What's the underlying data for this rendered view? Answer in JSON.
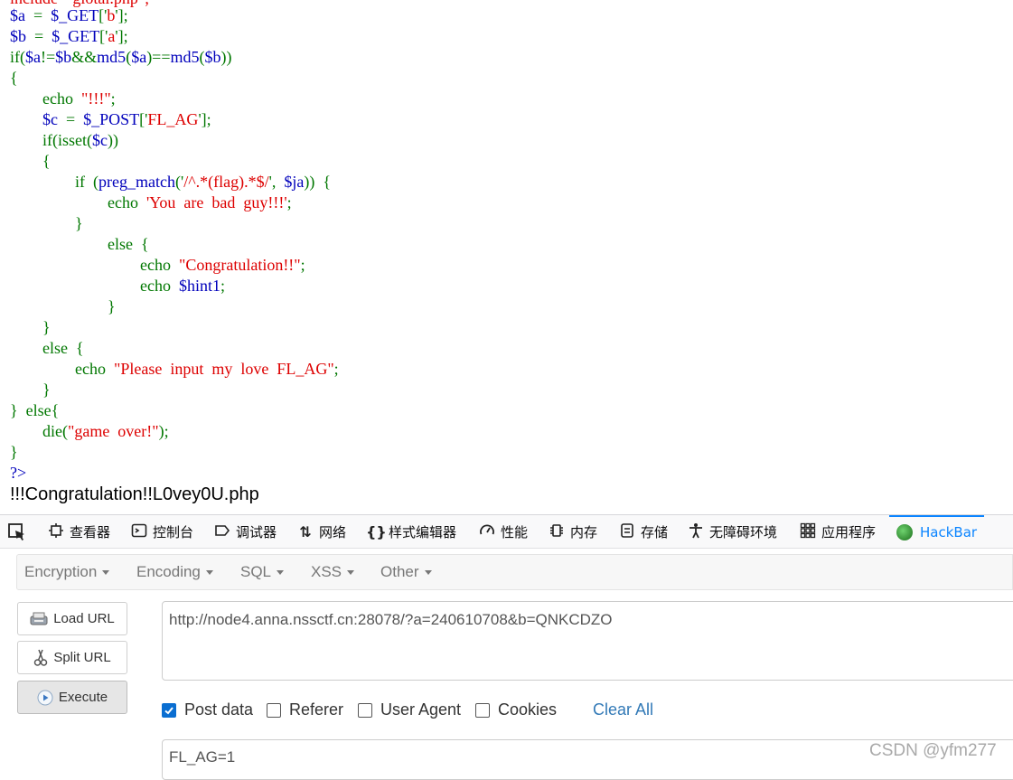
{
  "code_lines": [
    [
      {
        "t": "include  \"glotal.php\";",
        "c": "s"
      }
    ],
    [
      {
        "t": "$a",
        "c": "v"
      },
      {
        "t": "  =  ",
        "c": "k"
      },
      {
        "t": "$_GET",
        "c": "v"
      },
      {
        "t": "['",
        "c": "k"
      },
      {
        "t": "b",
        "c": "s"
      },
      {
        "t": "'];",
        "c": "k"
      }
    ],
    [
      {
        "t": "$b",
        "c": "v"
      },
      {
        "t": "  =  ",
        "c": "k"
      },
      {
        "t": "$_GET",
        "c": "v"
      },
      {
        "t": "['",
        "c": "k"
      },
      {
        "t": "a",
        "c": "s"
      },
      {
        "t": "'];",
        "c": "k"
      }
    ],
    [
      {
        "t": "if(",
        "c": "k"
      },
      {
        "t": "$a",
        "c": "v"
      },
      {
        "t": "!=",
        "c": "k"
      },
      {
        "t": "$b",
        "c": "v"
      },
      {
        "t": "&&",
        "c": "k"
      },
      {
        "t": "md5",
        "c": "v"
      },
      {
        "t": "(",
        "c": "k"
      },
      {
        "t": "$a",
        "c": "v"
      },
      {
        "t": ")==",
        "c": "k"
      },
      {
        "t": "md5",
        "c": "v"
      },
      {
        "t": "(",
        "c": "k"
      },
      {
        "t": "$b",
        "c": "v"
      },
      {
        "t": "))",
        "c": "k"
      }
    ],
    [
      {
        "t": "{",
        "c": "k"
      }
    ],
    [
      {
        "t": "        echo  ",
        "c": "k"
      },
      {
        "t": "\"!!!\"",
        "c": "s"
      },
      {
        "t": ";",
        "c": "k"
      }
    ],
    [
      {
        "t": "        ",
        "c": "k"
      },
      {
        "t": "$c",
        "c": "v"
      },
      {
        "t": "  =  ",
        "c": "k"
      },
      {
        "t": "$_POST",
        "c": "v"
      },
      {
        "t": "['",
        "c": "k"
      },
      {
        "t": "FL_AG",
        "c": "s"
      },
      {
        "t": "'];",
        "c": "k"
      }
    ],
    [
      {
        "t": "        if(isset(",
        "c": "k"
      },
      {
        "t": "$c",
        "c": "v"
      },
      {
        "t": "))",
        "c": "k"
      }
    ],
    [
      {
        "t": "        {",
        "c": "k"
      }
    ],
    [
      {
        "t": "                if  (",
        "c": "k"
      },
      {
        "t": "preg_match",
        "c": "v"
      },
      {
        "t": "('",
        "c": "k"
      },
      {
        "t": "/^.*(flag).*$/",
        "c": "s"
      },
      {
        "t": "',  ",
        "c": "k"
      },
      {
        "t": "$ja",
        "c": "v"
      },
      {
        "t": "))  {",
        "c": "k"
      }
    ],
    [
      {
        "t": "                        echo  ",
        "c": "k"
      },
      {
        "t": "'You  are  bad  guy!!!'",
        "c": "s"
      },
      {
        "t": ";",
        "c": "k"
      }
    ],
    [
      {
        "t": "                }",
        "c": "k"
      }
    ],
    [
      {
        "t": "                        else  {",
        "c": "k"
      }
    ],
    [
      {
        "t": "                                echo  ",
        "c": "k"
      },
      {
        "t": "\"Congratulation!!\"",
        "c": "s"
      },
      {
        "t": ";",
        "c": "k"
      }
    ],
    [
      {
        "t": "                                echo  ",
        "c": "k"
      },
      {
        "t": "$hint1",
        "c": "v"
      },
      {
        "t": ";",
        "c": "k"
      }
    ],
    [
      {
        "t": "                        }",
        "c": "k"
      }
    ],
    [
      {
        "t": "        }",
        "c": "k"
      }
    ],
    [
      {
        "t": "        else  {",
        "c": "k"
      }
    ],
    [
      {
        "t": "                echo  ",
        "c": "k"
      },
      {
        "t": "\"Please  input  my  love  FL_AG\"",
        "c": "s"
      },
      {
        "t": ";",
        "c": "k"
      }
    ],
    [
      {
        "t": "        }",
        "c": "k"
      }
    ],
    [
      {
        "t": "}  else{",
        "c": "k"
      }
    ],
    [
      {
        "t": "        die(",
        "c": "k"
      },
      {
        "t": "\"game  over!\"",
        "c": "s"
      },
      {
        "t": ");",
        "c": "k"
      }
    ],
    [
      {
        "t": "}",
        "c": "k"
      }
    ],
    [
      {
        "t": "?>",
        "c": "v"
      }
    ]
  ],
  "page_output": "!!!Congratulation!!L0vey0U.php",
  "devtools": {
    "tabs": [
      {
        "label": "查看器",
        "icon": "inspector-icon"
      },
      {
        "label": "控制台",
        "icon": "console-icon"
      },
      {
        "label": "调试器",
        "icon": "debugger-icon"
      },
      {
        "label": "网络",
        "icon": "network-icon"
      },
      {
        "label": "样式编辑器",
        "icon": "style-editor-icon"
      },
      {
        "label": "性能",
        "icon": "performance-icon"
      },
      {
        "label": "内存",
        "icon": "memory-icon"
      },
      {
        "label": "存储",
        "icon": "storage-icon"
      },
      {
        "label": "无障碍环境",
        "icon": "accessibility-icon"
      },
      {
        "label": "应用程序",
        "icon": "application-icon"
      },
      {
        "label": "HackBar",
        "icon": "hackbar-logo-icon",
        "active": true
      }
    ]
  },
  "hackbar": {
    "menus": [
      "Encryption",
      "Encoding",
      "SQL",
      "XSS",
      "Other"
    ],
    "buttons": {
      "load_url": "Load URL",
      "split_url": "Split URL",
      "execute": "Execute"
    },
    "url": "http://node4.anna.nssctf.cn:28078/?a=240610708&b=QNKCDZO",
    "options": [
      {
        "label": "Post data",
        "checked": true
      },
      {
        "label": "Referer",
        "checked": false
      },
      {
        "label": "User Agent",
        "checked": false
      },
      {
        "label": "Cookies",
        "checked": false
      }
    ],
    "clear_all": "Clear All",
    "post_data": "FL_AG=1",
    "colors": {
      "accent": "#0a84ff",
      "link": "#337ab7",
      "checkbox": "#0a6ed1"
    }
  },
  "watermark": "CSDN @yfm277"
}
